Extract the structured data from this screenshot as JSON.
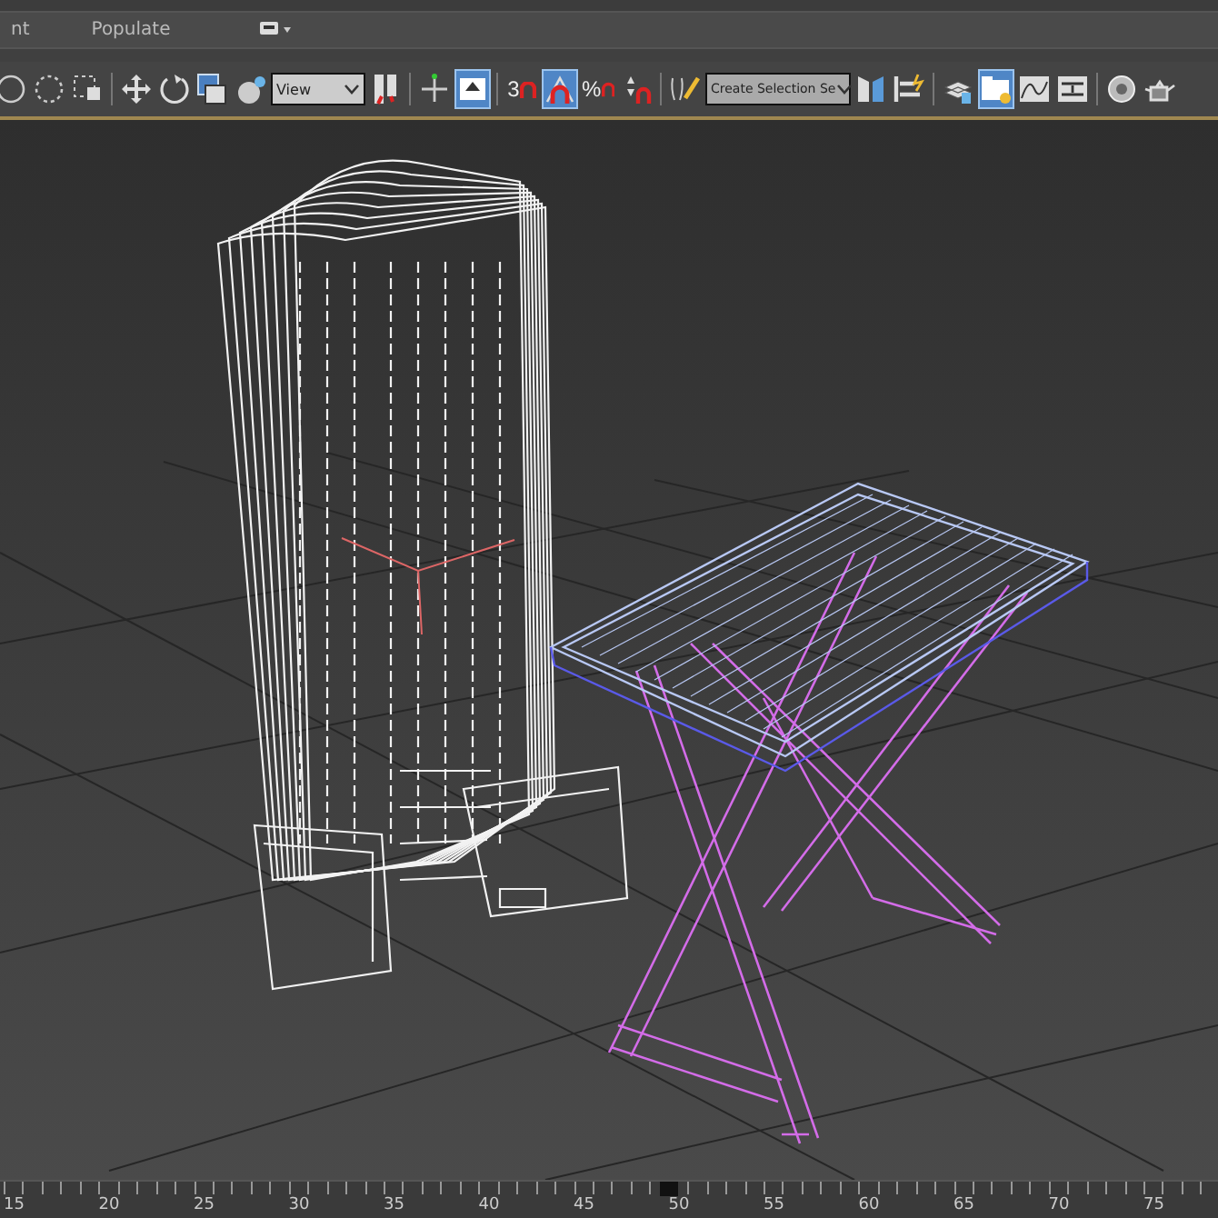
{
  "ribbon_tabs": [
    {
      "label": "nt",
      "selected": false
    },
    {
      "label": "Populate",
      "selected": false
    }
  ],
  "toolbar": [
    {
      "kind": "button",
      "selected": false
    },
    {
      "kind": "button",
      "selected": false
    },
    {
      "kind": "button",
      "selected": false
    },
    {
      "kind": "sep"
    },
    {
      "kind": "button",
      "selected": false
    },
    {
      "kind": "button",
      "selected": false
    },
    {
      "kind": "button",
      "selected": false
    },
    {
      "kind": "button",
      "selected": false
    },
    {
      "kind": "dropdown",
      "value": "View"
    },
    {
      "kind": "button",
      "selected": false
    },
    {
      "kind": "sep"
    },
    {
      "kind": "button",
      "selected": false
    },
    {
      "kind": "button",
      "selected": true
    },
    {
      "kind": "sep"
    },
    {
      "kind": "snap",
      "label": "3",
      "selected": false
    },
    {
      "kind": "button",
      "selected": true
    },
    {
      "kind": "snap",
      "label": "%",
      "selected": false
    },
    {
      "kind": "button",
      "selected": false
    },
    {
      "kind": "sep"
    },
    {
      "kind": "button",
      "selected": false
    },
    {
      "kind": "dropdown",
      "value": "Create Selection Se"
    },
    {
      "kind": "button",
      "selected": false
    },
    {
      "kind": "button",
      "selected": false
    },
    {
      "kind": "sep"
    },
    {
      "kind": "button",
      "selected": false
    },
    {
      "kind": "button",
      "selected": true
    },
    {
      "kind": "button",
      "selected": false
    },
    {
      "kind": "button",
      "selected": false
    },
    {
      "kind": "sep"
    },
    {
      "kind": "button",
      "selected": false
    },
    {
      "kind": "button",
      "selected": false
    }
  ],
  "timeline": {
    "labels": [
      "15",
      "20",
      "25",
      "30",
      "35",
      "40",
      "45",
      "50",
      "55",
      "60",
      "65",
      "70",
      "75"
    ]
  }
}
